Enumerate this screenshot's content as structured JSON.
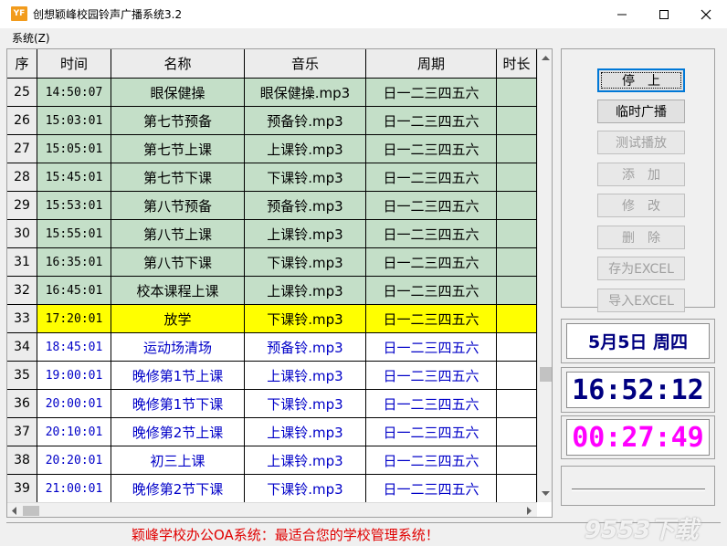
{
  "window": {
    "title": "创想颖峰校园铃声广播系统3.2",
    "app_icon": "YF"
  },
  "menu": {
    "system": "系统(Z)"
  },
  "table": {
    "columns": [
      "序",
      "时间",
      "名称",
      "音乐",
      "周期",
      "时长"
    ],
    "rows": [
      {
        "no": "25",
        "time": "14:50:07",
        "name": "眼保健操",
        "music": "眼保健操.mp3",
        "period": "日一二三四五六",
        "duration": "",
        "state": "past"
      },
      {
        "no": "26",
        "time": "15:03:01",
        "name": "第七节预备",
        "music": "预备铃.mp3",
        "period": "日一二三四五六",
        "duration": "",
        "state": "past"
      },
      {
        "no": "27",
        "time": "15:05:01",
        "name": "第七节上课",
        "music": "上课铃.mp3",
        "period": "日一二三四五六",
        "duration": "",
        "state": "past"
      },
      {
        "no": "28",
        "time": "15:45:01",
        "name": "第七节下课",
        "music": "下课铃.mp3",
        "period": "日一二三四五六",
        "duration": "",
        "state": "past"
      },
      {
        "no": "29",
        "time": "15:53:01",
        "name": "第八节预备",
        "music": "预备铃.mp3",
        "period": "日一二三四五六",
        "duration": "",
        "state": "past"
      },
      {
        "no": "30",
        "time": "15:55:01",
        "name": "第八节上课",
        "music": "上课铃.mp3",
        "period": "日一二三四五六",
        "duration": "",
        "state": "past"
      },
      {
        "no": "31",
        "time": "16:35:01",
        "name": "第八节下课",
        "music": "下课铃.mp3",
        "period": "日一二三四五六",
        "duration": "",
        "state": "past"
      },
      {
        "no": "32",
        "time": "16:45:01",
        "name": "校本课程上课",
        "music": "上课铃.mp3",
        "period": "日一二三四五六",
        "duration": "",
        "state": "past"
      },
      {
        "no": "33",
        "time": "17:20:01",
        "name": "放学",
        "music": "下课铃.mp3",
        "period": "日一二三四五六",
        "duration": "",
        "state": "next"
      },
      {
        "no": "34",
        "time": "18:45:01",
        "name": "运动场清场",
        "music": "预备铃.mp3",
        "period": "日一二三四五六",
        "duration": "",
        "state": "future"
      },
      {
        "no": "35",
        "time": "19:00:01",
        "name": "晚修第1节上课",
        "music": "上课铃.mp3",
        "period": "日一二三四五六",
        "duration": "",
        "state": "future"
      },
      {
        "no": "36",
        "time": "20:00:01",
        "name": "晚修第1节下课",
        "music": "下课铃.mp3",
        "period": "日一二三四五六",
        "duration": "",
        "state": "future"
      },
      {
        "no": "37",
        "time": "20:10:01",
        "name": "晚修第2节上课",
        "music": "上课铃.mp3",
        "period": "日一二三四五六",
        "duration": "",
        "state": "future"
      },
      {
        "no": "38",
        "time": "20:20:01",
        "name": "初三上课",
        "music": "上课铃.mp3",
        "period": "日一二三四五六",
        "duration": "",
        "state": "future"
      },
      {
        "no": "39",
        "time": "21:00:01",
        "name": "晚修第2节下课",
        "music": "下课铃.mp3",
        "period": "日一二三四五六",
        "duration": "",
        "state": "future"
      }
    ]
  },
  "buttons": {
    "stop": "停　上",
    "temp_broadcast": "临时广播",
    "test_play": "测试播放",
    "add": "添　加",
    "edit": "修　改",
    "delete": "删　除",
    "save_excel": "存为EXCEL",
    "import_excel": "导入EXCEL"
  },
  "info": {
    "date": "5月5日  周四",
    "clock": "16:52:12",
    "countdown": "00:27:49",
    "progress": 0
  },
  "status": {
    "ad_text": "颖峰学校办公OA系统：最适合您的学校管理系统！"
  },
  "watermark": "9553下载",
  "colors": {
    "past_row": "#c4dfc8",
    "next_row": "#ffff00",
    "future_text": "#0000c8",
    "date_color": "#000080",
    "clock_color": "#000080",
    "countdown_color": "#ff00ff",
    "status_color": "#e00000"
  }
}
